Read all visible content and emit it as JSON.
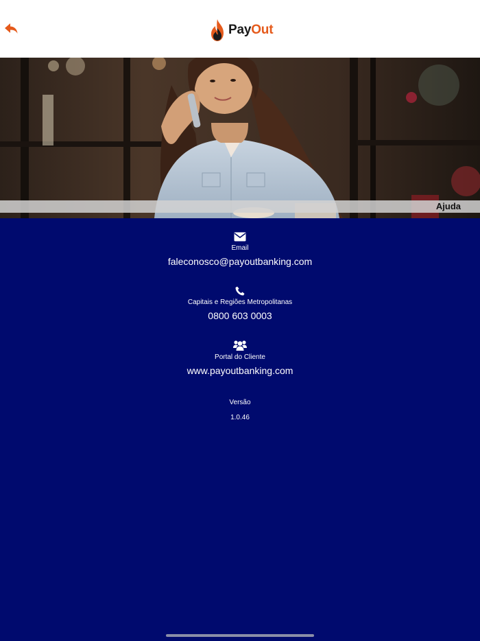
{
  "header": {
    "logo_pay": "Pay",
    "logo_out": "Out"
  },
  "hero": {
    "label": "Ajuda"
  },
  "contact": {
    "email": {
      "label": "Email",
      "value": "faleconosco@payoutbanking.com"
    },
    "phone": {
      "label": "Capitais e Regiões Metropolitanas",
      "value": "0800 603 0003"
    },
    "portal": {
      "label": "Portal do Cliente",
      "value": "www.payoutbanking.com"
    }
  },
  "version": {
    "label": "Versão",
    "value": "1.0.46"
  },
  "colors": {
    "background": "#000a6e",
    "accent": "#e55a1b"
  },
  "icons": {
    "back": "back-arrow-icon",
    "logo": "flame-logo-icon",
    "email": "envelope-icon",
    "phone": "phone-icon",
    "portal": "users-group-icon"
  }
}
